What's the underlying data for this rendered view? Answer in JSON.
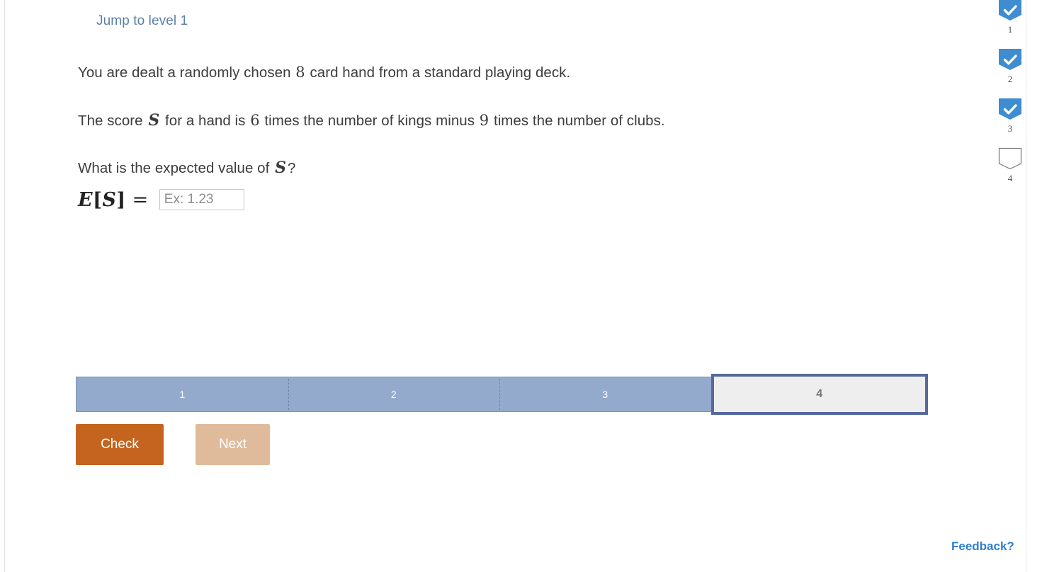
{
  "header": {
    "jump_link": "Jump to level 1"
  },
  "question": {
    "line1": {
      "part_a": "You are dealt a randomly chosen ",
      "num_cards": "8",
      "part_b": " card hand from a standard playing deck."
    },
    "line2": {
      "part_a": "The score ",
      "var_s": "S",
      "part_b": " for a hand is ",
      "kings_multiplier": "6",
      "part_c": " times the number of kings minus ",
      "clubs_multiplier": "9",
      "part_d": " times the number of clubs."
    },
    "line3": {
      "part_a": "What is the expected value of ",
      "var_s": "S",
      "part_b": "?"
    },
    "answer": {
      "label_e": "E",
      "label_bracket_open": "[",
      "label_s": "S",
      "label_bracket_close": "]",
      "label_equals": "=",
      "input_value": "",
      "input_placeholder": "Ex: 1.23"
    }
  },
  "progress": {
    "segments": [
      {
        "label": "1",
        "state": "filled"
      },
      {
        "label": "2",
        "state": "filled"
      },
      {
        "label": "3",
        "state": "filled"
      },
      {
        "label": "4",
        "state": "current"
      }
    ]
  },
  "actions": {
    "check_label": "Check",
    "next_label": "Next"
  },
  "footer": {
    "feedback_label": "Feedback?"
  },
  "rail": {
    "items": [
      {
        "number": "1",
        "checked": true
      },
      {
        "number": "2",
        "checked": true
      },
      {
        "number": "3",
        "checked": true
      },
      {
        "number": "4",
        "checked": false
      }
    ]
  },
  "colors": {
    "accent_blue": "#3d8dd0",
    "link_blue": "#2f7ed0",
    "jump_blue": "#5b7fa6",
    "progress_fill": "#93aacd",
    "progress_current_border": "#56699a",
    "check_orange": "#c4641f",
    "next_tan": "#e0bb9b"
  }
}
